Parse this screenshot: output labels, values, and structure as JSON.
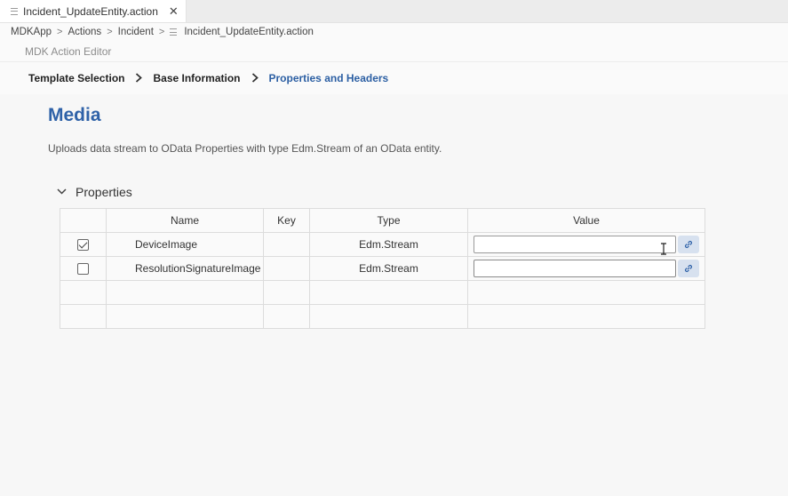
{
  "tab": {
    "filename": "Incident_UpdateEntity.action",
    "close_glyph": "✕"
  },
  "breadcrumb": {
    "items": [
      "MDKApp",
      "Actions",
      "Incident"
    ],
    "file": "Incident_UpdateEntity.action"
  },
  "editor": {
    "title": "MDK Action Editor"
  },
  "wizard": {
    "steps": [
      "Template Selection",
      "Base Information",
      "Properties and Headers"
    ],
    "active_step": "Properties and Headers"
  },
  "page": {
    "title": "Media",
    "description": "Uploads data stream to OData Properties with type Edm.Stream of an OData entity."
  },
  "section": {
    "title": "Properties",
    "toggle_icon": "chevron-down-icon"
  },
  "table": {
    "headers": {
      "name": "Name",
      "key": "Key",
      "type": "Type",
      "value": "Value"
    },
    "rows": [
      {
        "checked": true,
        "name": "DeviceImage",
        "key": "",
        "type": "Edm.Stream",
        "value": ""
      },
      {
        "checked": false,
        "name": "ResolutionSignatureImage",
        "key": "",
        "type": "Edm.Stream",
        "value": ""
      }
    ]
  },
  "colors": {
    "accent": "#2f62a8",
    "active_step": "#2c5fa3",
    "link_button_bg": "#d7e1ef"
  }
}
